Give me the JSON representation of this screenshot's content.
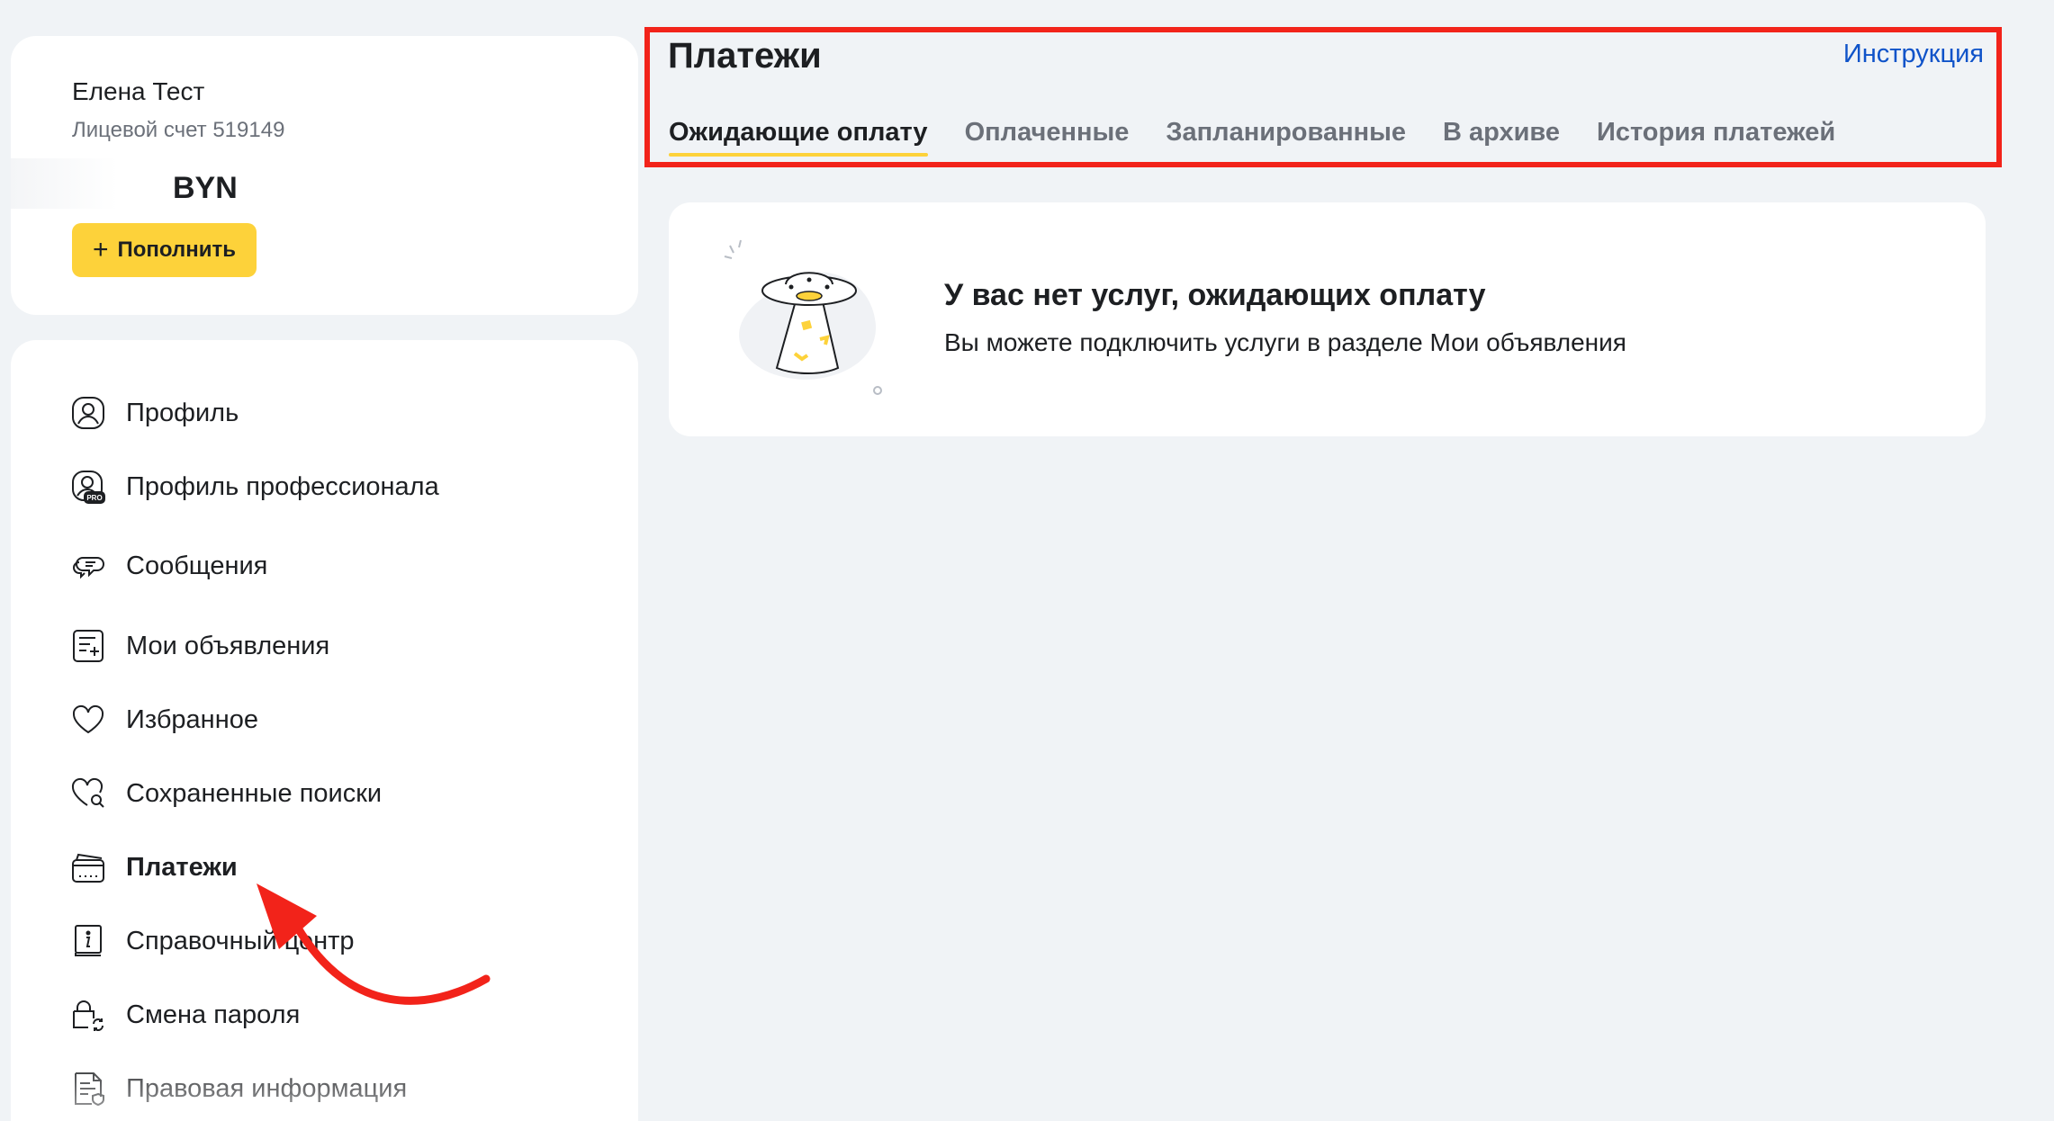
{
  "account": {
    "name": "Елена Тест",
    "account_number": "Лицевой счет 519149",
    "balance": "BYN",
    "topup_label": "Пополнить",
    "topup_icon": "plus-icon"
  },
  "sidebar": {
    "items": [
      {
        "label": "Профиль",
        "icon": "profile-icon",
        "active": false
      },
      {
        "label": "Профиль профессионала",
        "icon": "pro-profile-icon",
        "active": false
      },
      {
        "label": "Сообщения",
        "icon": "chat-icon",
        "active": false
      },
      {
        "label": "Мои объявления",
        "icon": "listings-icon",
        "active": false
      },
      {
        "label": "Избранное",
        "icon": "heart-icon",
        "active": false
      },
      {
        "label": "Сохраненные поиски",
        "icon": "saved-search-icon",
        "active": false
      },
      {
        "label": "Платежи",
        "icon": "wallet-icon",
        "active": true
      },
      {
        "label": "Справочный центр",
        "icon": "help-book-icon",
        "active": false
      },
      {
        "label": "Смена пароля",
        "icon": "lock-refresh-icon",
        "active": false
      },
      {
        "label": "Правовая информация",
        "icon": "legal-doc-icon",
        "active": false
      }
    ]
  },
  "header": {
    "title": "Платежи",
    "instruction_link": "Инструкция",
    "tabs": [
      {
        "label": "Ожидающие оплату",
        "active": true
      },
      {
        "label": "Оплаченные",
        "active": false
      },
      {
        "label": "Запланированные",
        "active": false
      },
      {
        "label": "В архиве",
        "active": false
      },
      {
        "label": "История платежей",
        "active": false
      }
    ]
  },
  "empty_state": {
    "title": "У вас нет услуг, ожидающих оплату",
    "subtitle": "Вы можете подключить услуги в разделе Мои объявления",
    "illustration": "ufo-illustration"
  },
  "colors": {
    "accent_yellow": "#fdd23a",
    "link_blue": "#0f53c9",
    "annotation_red": "#f2231a",
    "page_bg": "#f0f3f6"
  }
}
